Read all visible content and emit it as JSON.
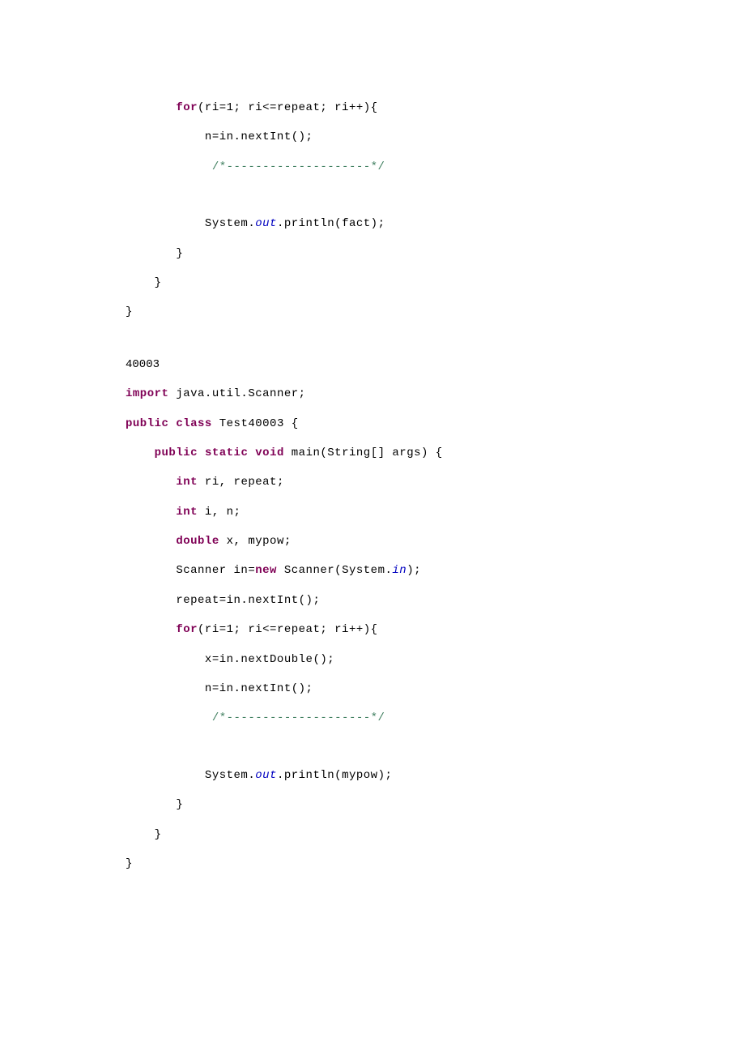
{
  "block1": {
    "l1_kw": "for",
    "l1_rest": "(ri=1; ri<=repeat; ri++){",
    "l2": "n=in.nextInt();",
    "l3_comment": "/*--------------------*/",
    "l4_a": "System.",
    "l4_static": "out",
    "l4_b": ".println(fact);",
    "l5": "}",
    "l6": "}",
    "l7": "}"
  },
  "label": "40003",
  "block2": {
    "l1_kw": "import",
    "l1_rest": " java.util.Scanner;",
    "l2_kw1": "public",
    "l2_kw2": "class",
    "l2_rest": " Test40003 {",
    "l3_kw1": "public",
    "l3_kw2": "static",
    "l3_kw3": "void",
    "l3_rest": " main(String[] args) {",
    "l4_kw": "int",
    "l4_rest": " ri, repeat;",
    "l5_kw": "int",
    "l5_rest": " i, n;",
    "l6_kw": "double",
    "l6_rest": " x, mypow;",
    "l7_a": "Scanner in=",
    "l7_kw": "new",
    "l7_b": " Scanner(System.",
    "l7_static": "in",
    "l7_c": ");",
    "l8": "repeat=in.nextInt();",
    "l9_kw": "for",
    "l9_rest": "(ri=1; ri<=repeat; ri++){",
    "l10": "x=in.nextDouble();",
    "l11": "n=in.nextInt();",
    "l12_comment": "/*--------------------*/",
    "l13_a": "System.",
    "l13_static": "out",
    "l13_b": ".println(mypow);",
    "l14": "}",
    "l15": "}",
    "l16": "}"
  }
}
